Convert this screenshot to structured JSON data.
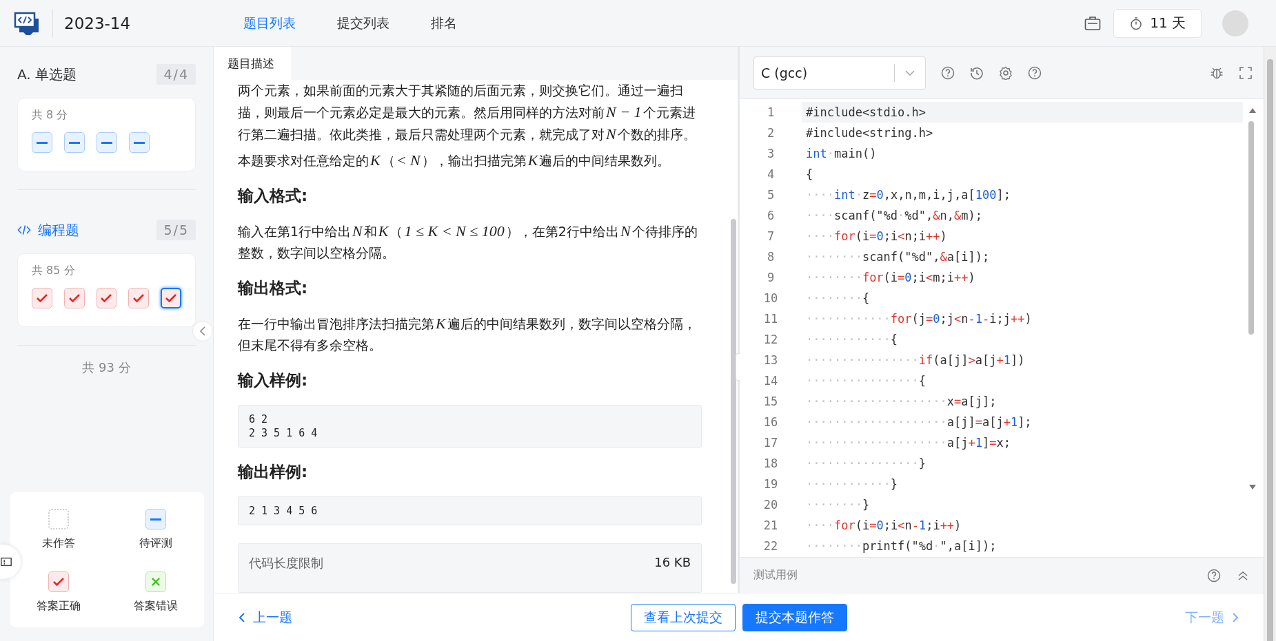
{
  "topbar": {
    "title": "2023-14",
    "tabs": [
      {
        "label": "题目列表",
        "selected": true
      },
      {
        "label": "提交列表",
        "selected": false
      },
      {
        "label": "排名",
        "selected": false
      }
    ],
    "countdown": "11 天"
  },
  "sidebar": {
    "sections": [
      {
        "kind": "choice",
        "title": "A. 单选题",
        "count": "4/4",
        "score": "共 8 分",
        "questions": [
          {
            "kind": "pending",
            "selected": false
          },
          {
            "kind": "pending",
            "selected": false
          },
          {
            "kind": "pending",
            "selected": false
          },
          {
            "kind": "pending",
            "selected": false
          }
        ]
      },
      {
        "kind": "programming",
        "title": "编程题",
        "count": "5/5",
        "score": "共 85 分",
        "questions": [
          {
            "kind": "correct",
            "selected": false
          },
          {
            "kind": "correct",
            "selected": false
          },
          {
            "kind": "correct",
            "selected": false
          },
          {
            "kind": "correct",
            "selected": false
          },
          {
            "kind": "correct",
            "selected": true
          }
        ]
      }
    ],
    "total": "共 93 分",
    "legend": [
      {
        "kind": "unanswered",
        "label": "未作答"
      },
      {
        "kind": "pending",
        "label": "待评测"
      },
      {
        "kind": "correct",
        "label": "答案正确"
      },
      {
        "kind": "wrong",
        "label": "答案错误"
      }
    ]
  },
  "problem": {
    "tab": "题目描述",
    "blocks": [
      {
        "kind": "paragraph",
        "parts": [
          {
            "kind": "text",
            "text": "两个元素，如果前面的元素大于其紧随的后面元素，则交换它们。通过一遍扫描，则最后一个元素必定是最大的元素。然后用同样的方法对前"
          },
          {
            "kind": "math",
            "text": "N − 1"
          },
          {
            "kind": "text",
            "text": "个元素进行第二遍扫描。依此类推，最后只需处理两个元素，就完成了对"
          },
          {
            "kind": "math",
            "text": "N"
          },
          {
            "kind": "text",
            "text": "个数的排序。"
          }
        ]
      },
      {
        "kind": "paragraph",
        "parts": [
          {
            "kind": "text",
            "text": "本题要求对任意给定的"
          },
          {
            "kind": "math",
            "text": "K"
          },
          {
            "kind": "text",
            "text": "（"
          },
          {
            "kind": "math",
            "text": "< N"
          },
          {
            "kind": "text",
            "text": "），输出扫描完第"
          },
          {
            "kind": "math",
            "text": "K"
          },
          {
            "kind": "text",
            "text": "遍后的中间结果数列。"
          }
        ]
      },
      {
        "kind": "heading",
        "text": "输入格式:"
      },
      {
        "kind": "paragraph",
        "parts": [
          {
            "kind": "text",
            "text": "输入在第1行中给出"
          },
          {
            "kind": "math",
            "text": "N"
          },
          {
            "kind": "text",
            "text": "和"
          },
          {
            "kind": "math",
            "text": "K"
          },
          {
            "kind": "text",
            "text": "（"
          },
          {
            "kind": "math",
            "text": "1 ≤ K < N ≤ 100"
          },
          {
            "kind": "text",
            "text": "），在第2行中给出"
          },
          {
            "kind": "math",
            "text": "N"
          },
          {
            "kind": "text",
            "text": "个待排序的整数，数字间以空格分隔。"
          }
        ]
      },
      {
        "kind": "heading",
        "text": "输出格式:"
      },
      {
        "kind": "paragraph",
        "parts": [
          {
            "kind": "text",
            "text": "在一行中输出冒泡排序法扫描完第"
          },
          {
            "kind": "math",
            "text": "K"
          },
          {
            "kind": "text",
            "text": "遍后的中间结果数列，数字间以空格分隔，但末尾不得有多余空格。"
          }
        ]
      },
      {
        "kind": "heading",
        "text": "输入样例:"
      },
      {
        "kind": "sample",
        "lines": [
          "6 2",
          "2 3 5 1 6 4"
        ]
      },
      {
        "kind": "heading",
        "text": "输出样例:"
      },
      {
        "kind": "sample",
        "lines": [
          "2 1 3 4 5 6"
        ]
      },
      {
        "kind": "limit",
        "label": "代码长度限制",
        "value": "16 KB"
      }
    ]
  },
  "editor": {
    "language": "C (gcc)",
    "lines": [
      {
        "number": "1",
        "tokens": [
          {
            "kind": "plain",
            "text": "#include<stdio.h>"
          }
        ]
      },
      {
        "number": "2",
        "tokens": [
          {
            "kind": "plain",
            "text": "#include<string.h>"
          }
        ]
      },
      {
        "number": "3",
        "tokens": [
          {
            "kind": "type",
            "text": "int"
          },
          {
            "kind": "space",
            "text": "·"
          },
          {
            "kind": "plain",
            "text": "main()"
          }
        ]
      },
      {
        "number": "4",
        "tokens": [
          {
            "kind": "plain",
            "text": "{"
          }
        ]
      },
      {
        "number": "5",
        "tokens": [
          {
            "kind": "space",
            "text": "····"
          },
          {
            "kind": "type",
            "text": "int"
          },
          {
            "kind": "space",
            "text": "·"
          },
          {
            "kind": "plain",
            "text": "z"
          },
          {
            "kind": "operator",
            "text": "="
          },
          {
            "kind": "number",
            "text": "0"
          },
          {
            "kind": "plain",
            "text": ",x,n,m,i,j,a["
          },
          {
            "kind": "number",
            "text": "100"
          },
          {
            "kind": "plain",
            "text": "];"
          }
        ]
      },
      {
        "number": "6",
        "tokens": [
          {
            "kind": "space",
            "text": "····"
          },
          {
            "kind": "plain",
            "text": "scanf(\"%d"
          },
          {
            "kind": "space",
            "text": "·"
          },
          {
            "kind": "plain",
            "text": "%d\","
          },
          {
            "kind": "operator",
            "text": "&"
          },
          {
            "kind": "plain",
            "text": "n,"
          },
          {
            "kind": "operator",
            "text": "&"
          },
          {
            "kind": "plain",
            "text": "m);"
          }
        ]
      },
      {
        "number": "7",
        "tokens": [
          {
            "kind": "space",
            "text": "····"
          },
          {
            "kind": "control",
            "text": "for"
          },
          {
            "kind": "plain",
            "text": "(i"
          },
          {
            "kind": "operator",
            "text": "="
          },
          {
            "kind": "number",
            "text": "0"
          },
          {
            "kind": "plain",
            "text": ";i"
          },
          {
            "kind": "operator",
            "text": "<"
          },
          {
            "kind": "plain",
            "text": "n;i"
          },
          {
            "kind": "operator",
            "text": "++"
          },
          {
            "kind": "plain",
            "text": ")"
          }
        ]
      },
      {
        "number": "8",
        "tokens": [
          {
            "kind": "space",
            "text": "········"
          },
          {
            "kind": "plain",
            "text": "scanf(\"%d\","
          },
          {
            "kind": "operator",
            "text": "&"
          },
          {
            "kind": "plain",
            "text": "a[i]);"
          }
        ]
      },
      {
        "number": "9",
        "tokens": [
          {
            "kind": "space",
            "text": "········"
          },
          {
            "kind": "control",
            "text": "for"
          },
          {
            "kind": "plain",
            "text": "(i"
          },
          {
            "kind": "operator",
            "text": "="
          },
          {
            "kind": "number",
            "text": "0"
          },
          {
            "kind": "plain",
            "text": ";i"
          },
          {
            "kind": "operator",
            "text": "<"
          },
          {
            "kind": "plain",
            "text": "m;i"
          },
          {
            "kind": "operator",
            "text": "++"
          },
          {
            "kind": "plain",
            "text": ")"
          }
        ]
      },
      {
        "number": "10",
        "tokens": [
          {
            "kind": "space",
            "text": "········"
          },
          {
            "kind": "plain",
            "text": "{"
          }
        ]
      },
      {
        "number": "11",
        "tokens": [
          {
            "kind": "space",
            "text": "············"
          },
          {
            "kind": "control",
            "text": "for"
          },
          {
            "kind": "plain",
            "text": "(j"
          },
          {
            "kind": "operator",
            "text": "="
          },
          {
            "kind": "number",
            "text": "0"
          },
          {
            "kind": "plain",
            "text": ";j"
          },
          {
            "kind": "operator",
            "text": "<"
          },
          {
            "kind": "plain",
            "text": "n"
          },
          {
            "kind": "operator",
            "text": "-"
          },
          {
            "kind": "number",
            "text": "1"
          },
          {
            "kind": "operator",
            "text": "-"
          },
          {
            "kind": "plain",
            "text": "i;j"
          },
          {
            "kind": "operator",
            "text": "++"
          },
          {
            "kind": "plain",
            "text": ")"
          }
        ]
      },
      {
        "number": "12",
        "tokens": [
          {
            "kind": "space",
            "text": "············"
          },
          {
            "kind": "plain",
            "text": "{"
          }
        ]
      },
      {
        "number": "13",
        "tokens": [
          {
            "kind": "space",
            "text": "················"
          },
          {
            "kind": "control",
            "text": "if"
          },
          {
            "kind": "plain",
            "text": "(a[j]"
          },
          {
            "kind": "operator",
            "text": ">"
          },
          {
            "kind": "plain",
            "text": "a[j"
          },
          {
            "kind": "operator",
            "text": "+"
          },
          {
            "kind": "number",
            "text": "1"
          },
          {
            "kind": "plain",
            "text": "])"
          }
        ]
      },
      {
        "number": "14",
        "tokens": [
          {
            "kind": "space",
            "text": "················"
          },
          {
            "kind": "plain",
            "text": "{"
          }
        ]
      },
      {
        "number": "15",
        "tokens": [
          {
            "kind": "space",
            "text": "····················"
          },
          {
            "kind": "plain",
            "text": "x"
          },
          {
            "kind": "operator",
            "text": "="
          },
          {
            "kind": "plain",
            "text": "a[j];"
          }
        ]
      },
      {
        "number": "16",
        "tokens": [
          {
            "kind": "space",
            "text": "····················"
          },
          {
            "kind": "plain",
            "text": "a[j]"
          },
          {
            "kind": "operator",
            "text": "="
          },
          {
            "kind": "plain",
            "text": "a[j"
          },
          {
            "kind": "operator",
            "text": "+"
          },
          {
            "kind": "number",
            "text": "1"
          },
          {
            "kind": "plain",
            "text": "];"
          }
        ]
      },
      {
        "number": "17",
        "tokens": [
          {
            "kind": "space",
            "text": "····················"
          },
          {
            "kind": "plain",
            "text": "a[j"
          },
          {
            "kind": "operator",
            "text": "+"
          },
          {
            "kind": "number",
            "text": "1"
          },
          {
            "kind": "plain",
            "text": "]"
          },
          {
            "kind": "operator",
            "text": "="
          },
          {
            "kind": "plain",
            "text": "x;"
          }
        ]
      },
      {
        "number": "18",
        "tokens": [
          {
            "kind": "space",
            "text": "················"
          },
          {
            "kind": "plain",
            "text": "}"
          }
        ]
      },
      {
        "number": "19",
        "tokens": [
          {
            "kind": "space",
            "text": "············"
          },
          {
            "kind": "plain",
            "text": "}"
          }
        ]
      },
      {
        "number": "20",
        "tokens": [
          {
            "kind": "space",
            "text": "········"
          },
          {
            "kind": "plain",
            "text": "}"
          }
        ]
      },
      {
        "number": "21",
        "tokens": [
          {
            "kind": "space",
            "text": "····"
          },
          {
            "kind": "control",
            "text": "for"
          },
          {
            "kind": "plain",
            "text": "(i"
          },
          {
            "kind": "operator",
            "text": "="
          },
          {
            "kind": "number",
            "text": "0"
          },
          {
            "kind": "plain",
            "text": ";i"
          },
          {
            "kind": "operator",
            "text": "<"
          },
          {
            "kind": "plain",
            "text": "n"
          },
          {
            "kind": "operator",
            "text": "-"
          },
          {
            "kind": "number",
            "text": "1"
          },
          {
            "kind": "plain",
            "text": ";i"
          },
          {
            "kind": "operator",
            "text": "++"
          },
          {
            "kind": "plain",
            "text": ")"
          }
        ]
      },
      {
        "number": "22",
        "tokens": [
          {
            "kind": "space",
            "text": "········"
          },
          {
            "kind": "plain",
            "text": "printf(\"%d"
          },
          {
            "kind": "space",
            "text": "·"
          },
          {
            "kind": "plain",
            "text": "\",a[i]);"
          }
        ]
      }
    ],
    "test_cases_label": "测试用例"
  },
  "footer": {
    "previous": "上一题",
    "view_last": "查看上次提交",
    "submit": "提交本题作答",
    "next": "下一题"
  }
}
